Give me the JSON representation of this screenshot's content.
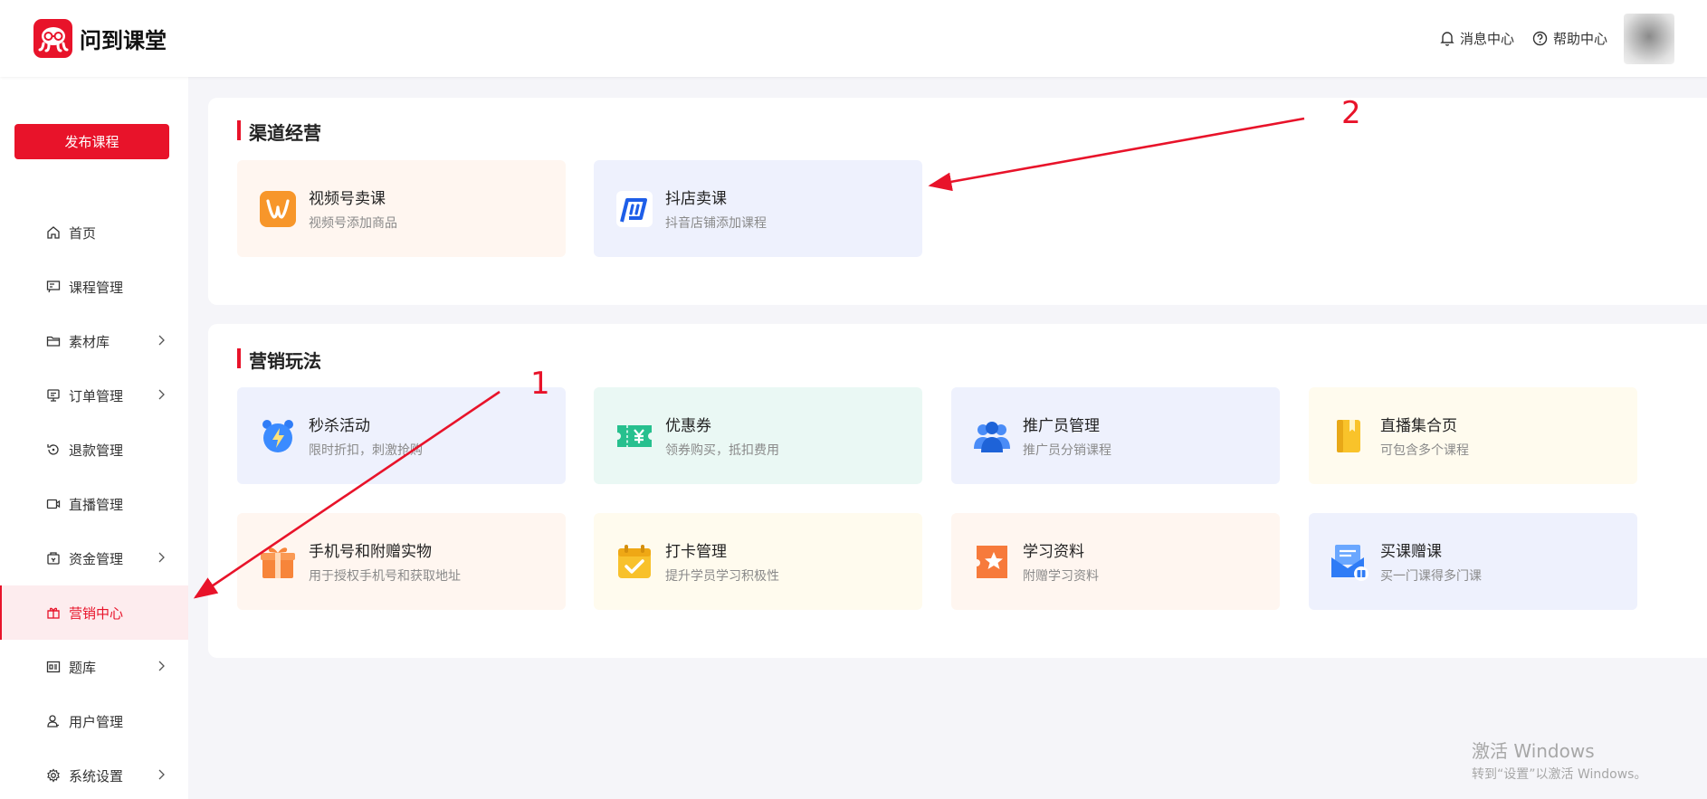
{
  "header": {
    "brand": "问到课堂",
    "message_center": "消息中心",
    "help_center": "帮助中心"
  },
  "sidebar": {
    "publish_label": "发布课程",
    "items": [
      {
        "label": "首页",
        "icon": "home-icon",
        "has_submenu": false
      },
      {
        "label": "课程管理",
        "icon": "course-icon",
        "has_submenu": false
      },
      {
        "label": "素材库",
        "icon": "folder-icon",
        "has_submenu": true
      },
      {
        "label": "订单管理",
        "icon": "order-icon",
        "has_submenu": true
      },
      {
        "label": "退款管理",
        "icon": "refund-icon",
        "has_submenu": false
      },
      {
        "label": "直播管理",
        "icon": "video-icon",
        "has_submenu": false
      },
      {
        "label": "资金管理",
        "icon": "wallet-icon",
        "has_submenu": true
      },
      {
        "label": "营销中心",
        "icon": "gift-icon",
        "has_submenu": false,
        "active": true
      },
      {
        "label": "题库",
        "icon": "question-bank-icon",
        "has_submenu": true
      },
      {
        "label": "用户管理",
        "icon": "user-icon",
        "has_submenu": false
      },
      {
        "label": "系统设置",
        "icon": "gear-icon",
        "has_submenu": true
      }
    ]
  },
  "channel": {
    "title": "渠道经营",
    "cards": [
      {
        "title": "视频号卖课",
        "desc": "视频号添加商品"
      },
      {
        "title": "抖店卖课",
        "desc": "抖音店铺添加课程"
      }
    ]
  },
  "marketing": {
    "title": "营销玩法",
    "cards": [
      {
        "title": "秒杀活动",
        "desc": "限时折扣，刺激抢购"
      },
      {
        "title": "优惠券",
        "desc": "领券购买，抵扣费用"
      },
      {
        "title": "推广员管理",
        "desc": "推广员分销课程"
      },
      {
        "title": "直播集合页",
        "desc": "可包含多个课程"
      },
      {
        "title": "手机号和附赠实物",
        "desc": "用于授权手机号和获取地址"
      },
      {
        "title": "打卡管理",
        "desc": "提升学员学习积极性"
      },
      {
        "title": "学习资料",
        "desc": "附赠学习资料"
      },
      {
        "title": "买课赠课",
        "desc": "买一门课得多门课"
      }
    ]
  },
  "annotations": {
    "label_1": "1",
    "label_2": "2"
  },
  "watermark": {
    "line1": "激活 Windows",
    "line2": "转到“设置”以激活 Windows。"
  },
  "colors": {
    "brand_red": "#e8132a",
    "card_orange": "#fff6f0",
    "card_blue": "#eef1fd",
    "card_green": "#eaf8f4",
    "card_yellow": "#fffbee"
  }
}
